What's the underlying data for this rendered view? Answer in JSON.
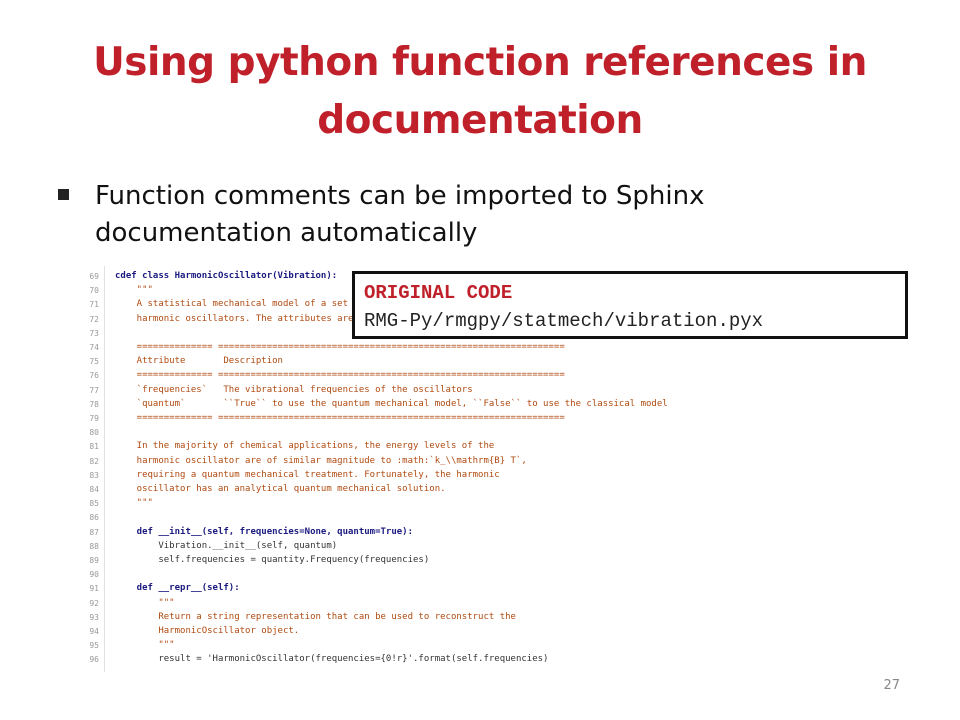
{
  "slide": {
    "title": "Using python function references in documentation",
    "bullet": "Function comments can be imported to Sphinx documentation automatically",
    "page_number": "27"
  },
  "callout": {
    "title": "ORIGINAL CODE",
    "path": "RMG-Py/rmgpy/statmech/vibration.pyx"
  },
  "code": {
    "lines": [
      {
        "n": "69",
        "t": "cdef class HarmonicOscillator(Vibration):"
      },
      {
        "n": "70",
        "t": "    \"\"\""
      },
      {
        "n": "71",
        "t": "    A statistical mechanical model of a set"
      },
      {
        "n": "72",
        "t": "    harmonic oscillators. The attributes are"
      },
      {
        "n": "73",
        "t": ""
      },
      {
        "n": "74",
        "t": "    ============== ================================================================"
      },
      {
        "n": "75",
        "t": "    Attribute       Description"
      },
      {
        "n": "76",
        "t": "    ============== ================================================================"
      },
      {
        "n": "77",
        "t": "    `frequencies`   The vibrational frequencies of the oscillators"
      },
      {
        "n": "78",
        "t": "    `quantum`       ``True`` to use the quantum mechanical model, ``False`` to use the classical model"
      },
      {
        "n": "79",
        "t": "    ============== ================================================================"
      },
      {
        "n": "80",
        "t": ""
      },
      {
        "n": "81",
        "t": "    In the majority of chemical applications, the energy levels of the"
      },
      {
        "n": "82",
        "t": "    harmonic oscillator are of similar magnitude to :math:`k_\\\\mathrm{B} T`,"
      },
      {
        "n": "83",
        "t": "    requiring a quantum mechanical treatment. Fortunately, the harmonic"
      },
      {
        "n": "84",
        "t": "    oscillator has an analytical quantum mechanical solution."
      },
      {
        "n": "85",
        "t": "    \"\"\""
      },
      {
        "n": "86",
        "t": ""
      },
      {
        "n": "87",
        "t": "    def __init__(self, frequencies=None, quantum=True):"
      },
      {
        "n": "88",
        "t": "        Vibration.__init__(self, quantum)"
      },
      {
        "n": "89",
        "t": "        self.frequencies = quantity.Frequency(frequencies)"
      },
      {
        "n": "90",
        "t": ""
      },
      {
        "n": "91",
        "t": "    def __repr__(self):"
      },
      {
        "n": "92",
        "t": "        \"\"\""
      },
      {
        "n": "93",
        "t": "        Return a string representation that can be used to reconstruct the"
      },
      {
        "n": "94",
        "t": "        HarmonicOscillator object."
      },
      {
        "n": "95",
        "t": "        \"\"\""
      },
      {
        "n": "96",
        "t": "        result = 'HarmonicOscillator(frequencies={0!r}'.format(self.frequencies)"
      }
    ]
  }
}
